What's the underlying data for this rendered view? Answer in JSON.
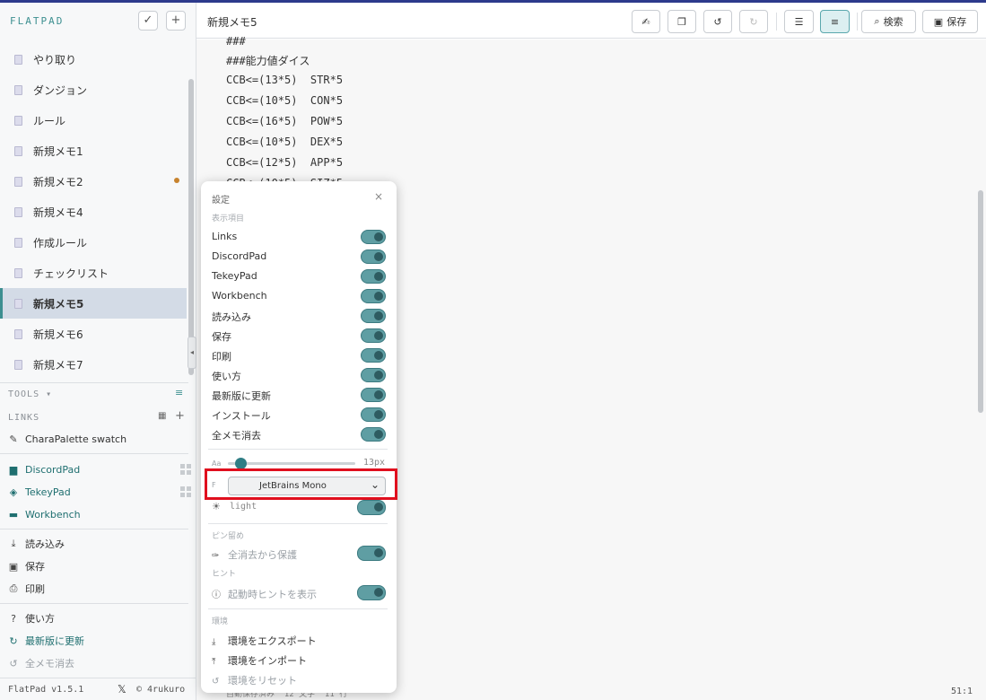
{
  "app": {
    "brand": "FLATPAD",
    "version": "FlatPad v1.5.1",
    "author": "© 4rukuro"
  },
  "sidebar": {
    "memos": [
      {
        "label": "やり取り"
      },
      {
        "label": "ダンジョン"
      },
      {
        "label": "ルール"
      },
      {
        "label": "新規メモ1"
      },
      {
        "label": "新規メモ2",
        "unsaved": true
      },
      {
        "label": "新規メモ4"
      },
      {
        "label": "作成ルール"
      },
      {
        "label": "チェックリスト"
      },
      {
        "label": "新規メモ5",
        "active": true
      },
      {
        "label": "新規メモ6"
      },
      {
        "label": "新規メモ7"
      }
    ],
    "tools_label": "TOOLS",
    "links_label": "LINKS",
    "links": [
      "CharaPalette swatch"
    ],
    "apps": [
      "DiscordPad",
      "TekeyPad",
      "Workbench"
    ],
    "file_actions": [
      "読み込み",
      "保存",
      "印刷"
    ],
    "misc_actions": [
      "使い方",
      "最新版に更新",
      "全メモ消去"
    ]
  },
  "header": {
    "title": "新規メモ5",
    "search_label": "検索",
    "save_label": "保存"
  },
  "editor": {
    "lines": [
      "###",
      "###能力値ダイス",
      "CCB<=(13*5)  STR*5",
      "CCB<=(10*5)  CON*5",
      "CCB<=(16*5)  POW*5",
      "CCB<=(10*5)  DEX*5",
      "CCB<=(12*5)  APP*5",
      "CCB<=(10*5)  SIZ*5"
    ],
    "cursor_pos": "51:1",
    "status_left": "自動保存済み  12 文字  11 行"
  },
  "settings": {
    "title": "設定",
    "close": "×",
    "display_section": "表示項目",
    "items": [
      "Links",
      "DiscordPad",
      "TekeyPad",
      "Workbench",
      "読み込み",
      "保存",
      "印刷",
      "使い方",
      "最新版に更新",
      "インストール",
      "全メモ消去"
    ],
    "font_size_label": "Aa",
    "font_size_value": "13px",
    "font_label": "F",
    "font_selected": "JetBrains Mono",
    "theme_label": "light",
    "pin_section": "ピン留め",
    "pin_item": "全消去から保護",
    "hint_section": "ヒント",
    "hint_item": "起動時ヒントを表示",
    "env_section": "環境",
    "env_actions": [
      "環境をエクスポート",
      "環境をインポート",
      "環境をリセット"
    ]
  },
  "colors": {
    "accent": "#3d8f90",
    "toggle_on": "#5f9ea3",
    "highlight_box": "#e00f1e",
    "active_memo": "#d3dbe6"
  }
}
